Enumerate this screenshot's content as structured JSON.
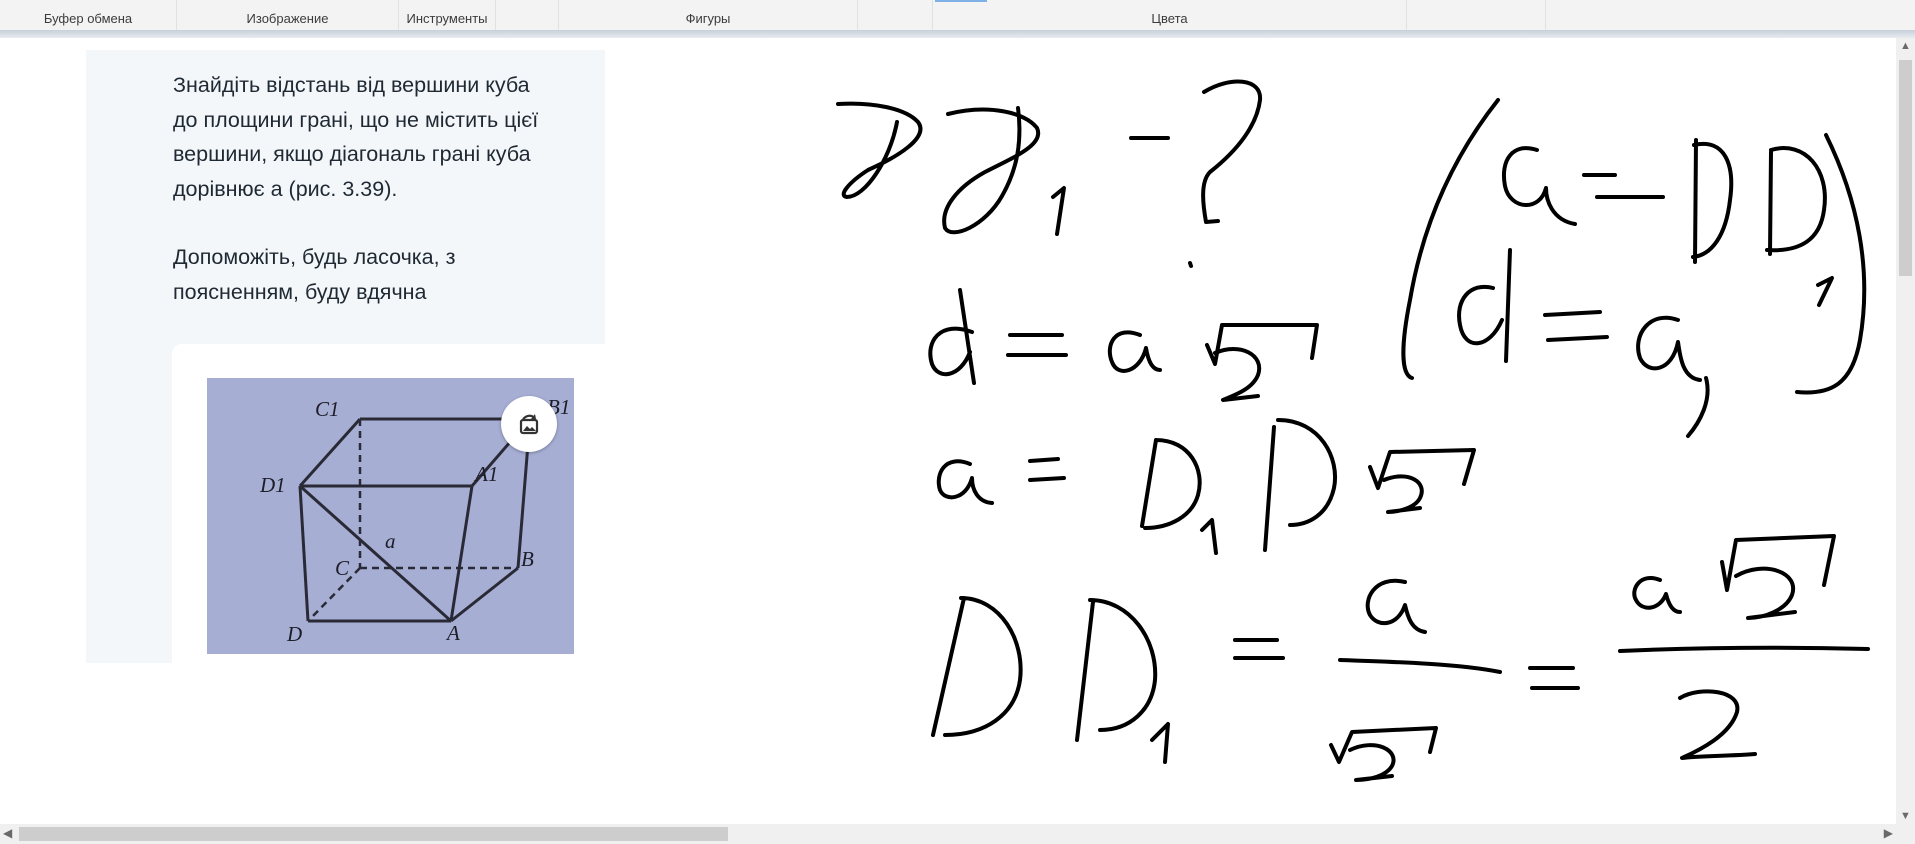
{
  "ribbon": {
    "groups": [
      "Буфер обмена",
      "Изображение",
      "Инструменты",
      "",
      "Фигуры",
      "",
      "Цвета",
      "",
      ""
    ]
  },
  "question": {
    "paragraph1": [
      "Знайдіть відстань від вершини куба",
      "до площини грані, що не містить цієї",
      "вершини, якщо діагональ грані куба",
      "дорівнює а (рис. 3.39)."
    ],
    "paragraph2": [
      "Допоможіть, будь ласочка, з",
      "поясненням, буду вдячна"
    ]
  },
  "figure": {
    "labels": [
      "C1",
      "B1",
      "D1",
      "A1",
      "a",
      "C",
      "B",
      "D",
      "A"
    ]
  },
  "icons": {
    "photo_button": "image-rotate-icon",
    "scroll_up": "arrow-up-icon",
    "scroll_down": "arrow-down-icon",
    "scroll_left": "arrow-left-icon",
    "scroll_right": "arrow-right-icon"
  },
  "colors": {
    "ribbon_bg": "#f3f3f3",
    "panel_bg": "#f4f7fa",
    "photo_bg": "#a6aed4",
    "ink": "#000000"
  }
}
